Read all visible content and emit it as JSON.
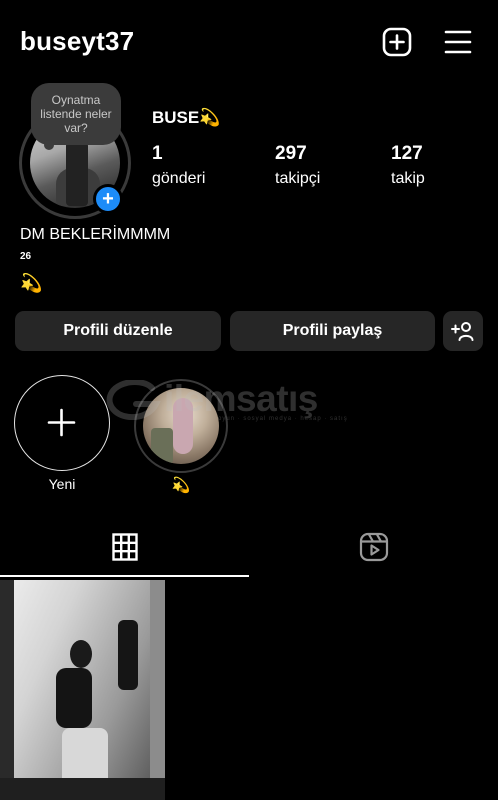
{
  "header": {
    "username": "buseyt37",
    "icons": [
      "add-post-icon",
      "menu-icon"
    ]
  },
  "profile": {
    "note_text": "Oynatma listende neler var?",
    "display_name": "BUSE💫",
    "stats": [
      {
        "value": "1",
        "label": "gönderi"
      },
      {
        "value": "297",
        "label": "takipçi"
      },
      {
        "value": "127",
        "label": "takip"
      }
    ],
    "bio_line1": "DM BEKLERİMMMM",
    "bio_line2": "26",
    "bio_line3": "💫"
  },
  "actions": {
    "edit_label": "Profili düzenle",
    "share_label": "Profili paylaş"
  },
  "highlights": {
    "new_label": "Yeni",
    "items": [
      {
        "label": "💫"
      }
    ]
  },
  "watermark": {
    "text": "ilemsatış",
    "sub": "oyun · sosyal medya · hesap · satış"
  },
  "tabs": [
    "grid-icon",
    "reels-icon"
  ],
  "colors": {
    "background": "#000000",
    "button": "#262626",
    "accent": "#1d8cf8"
  }
}
